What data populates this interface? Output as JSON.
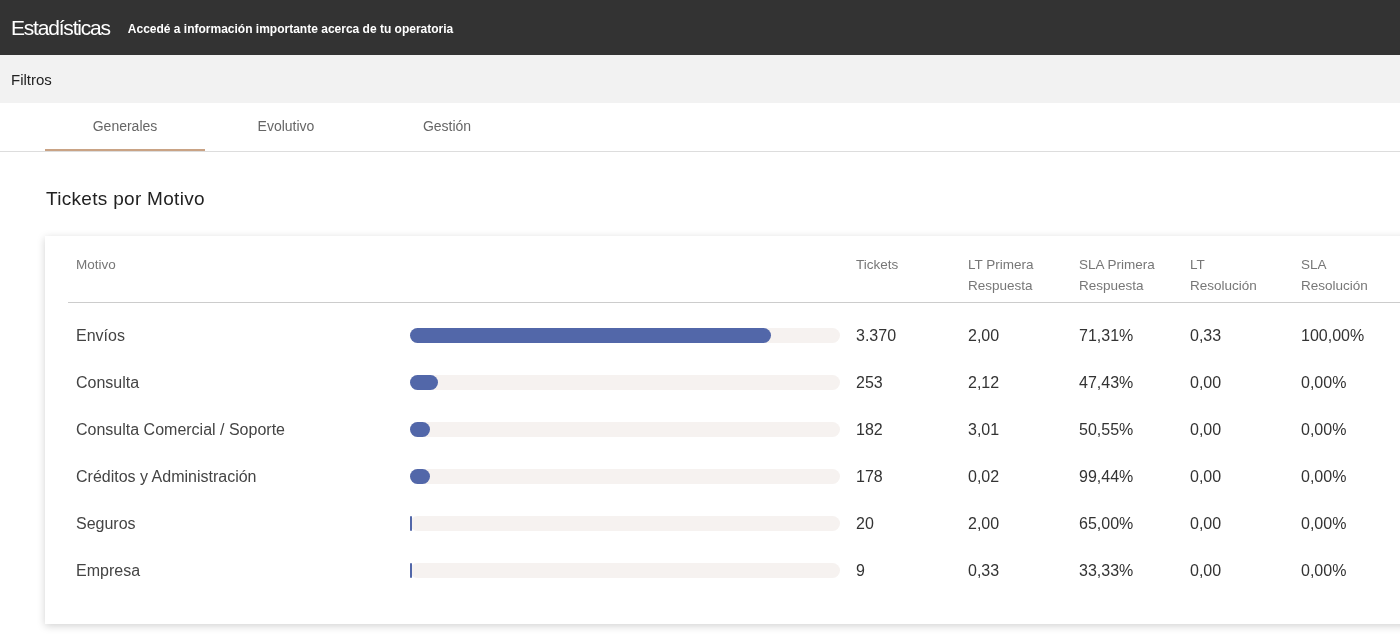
{
  "header": {
    "title": "Estadísticas",
    "subtitle": "Accedé a información importante acerca de tu operatoria"
  },
  "filters": {
    "label": "Filtros"
  },
  "tabs": [
    {
      "label": "Generales",
      "selected": true
    },
    {
      "label": "Evolutivo",
      "selected": false
    },
    {
      "label": "Gestión",
      "selected": false
    }
  ],
  "section": {
    "title": "Tickets por Motivo"
  },
  "table": {
    "columns": [
      "Motivo",
      "Tickets",
      "LT Primera Respuesta",
      "SLA Primera Respuesta",
      "LT Resolución",
      "SLA Resolución"
    ],
    "rows": [
      {
        "level": 0.84,
        "cells": [
          "Envíos",
          "3.370",
          "2,00",
          "71,31%",
          "0,33",
          "100,00%"
        ]
      },
      {
        "level": 0.065,
        "cells": [
          "Consulta",
          "253",
          "2,12",
          "47,43%",
          "0,00",
          "0,00%"
        ]
      },
      {
        "level": 0.047,
        "cells": [
          "Consulta Comercial / Soporte",
          "182",
          "3,01",
          "50,55%",
          "0,00",
          "0,00%"
        ]
      },
      {
        "level": 0.047,
        "cells": [
          "Créditos y Administración",
          "178",
          "0,02",
          "99,44%",
          "0,00",
          "0,00%"
        ]
      },
      {
        "level": 0.005,
        "cells": [
          "Seguros",
          "20",
          "2,00",
          "65,00%",
          "0,00",
          "0,00%"
        ]
      },
      {
        "level": 0.003,
        "cells": [
          "Empresa",
          "9",
          "0,33",
          "33,33%",
          "0,00",
          "0,00%"
        ]
      }
    ]
  }
}
